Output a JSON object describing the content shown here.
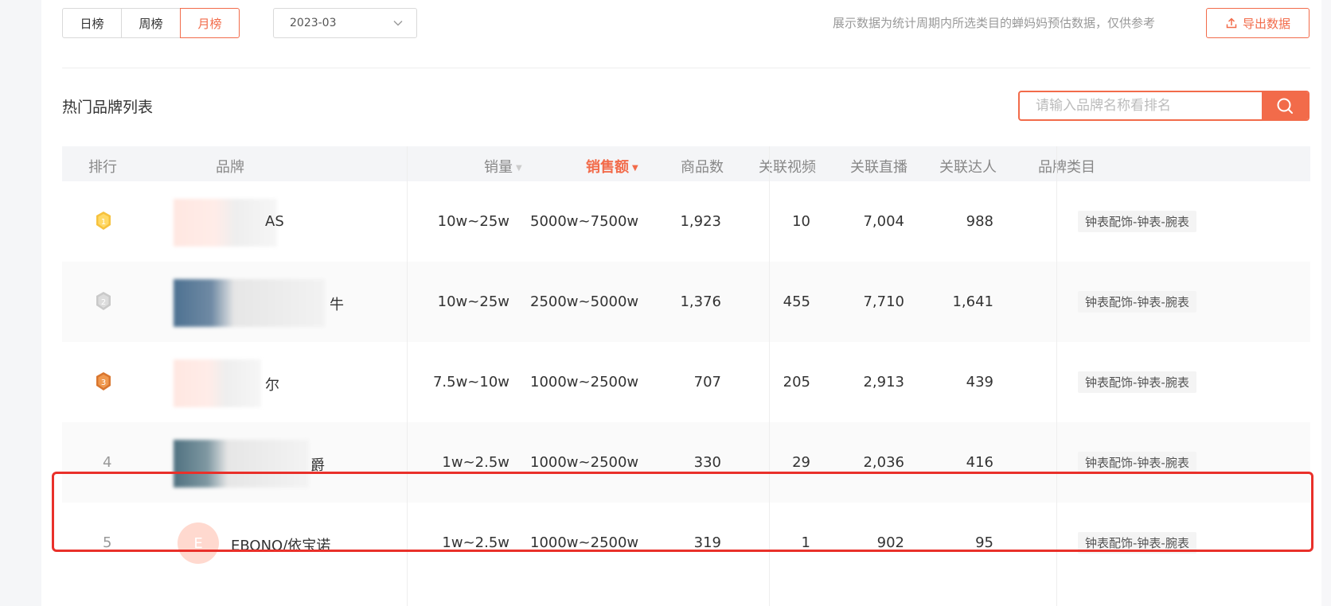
{
  "period_tabs": [
    {
      "label": "日榜",
      "active": false
    },
    {
      "label": "周榜",
      "active": false
    },
    {
      "label": "月榜",
      "active": true
    }
  ],
  "month_select": {
    "value": "2023-03"
  },
  "notice": "展示数据为统计周期内所选类目的蝉妈妈预估数据，仅供参考",
  "export_label": "导出数据",
  "section_title": "热门品牌列表",
  "search": {
    "placeholder": "请输入品牌名称看排名"
  },
  "colors": {
    "accent": "#f26b4a",
    "highlight": "#e9302a"
  },
  "table": {
    "headers": {
      "rank": "排行",
      "brand": "品牌",
      "sales": "销量",
      "revenue": "销售额",
      "products": "商品数",
      "videos": "关联视频",
      "lives": "关联直播",
      "creators": "关联达人",
      "category": "品牌类目"
    },
    "rows": [
      {
        "rank": "1",
        "brand": "AS",
        "sales": "10w~25w",
        "revenue": "5000w~7500w",
        "products": "1,923",
        "videos": "10",
        "lives": "7,004",
        "creators": "988",
        "category": "钟表配饰-钟表-腕表"
      },
      {
        "rank": "2",
        "brand": "牛",
        "sales": "10w~25w",
        "revenue": "2500w~5000w",
        "products": "1,376",
        "videos": "455",
        "lives": "7,710",
        "creators": "1,641",
        "category": "钟表配饰-钟表-腕表"
      },
      {
        "rank": "3",
        "brand": "尔",
        "sales": "7.5w~10w",
        "revenue": "1000w~2500w",
        "products": "707",
        "videos": "205",
        "lives": "2,913",
        "creators": "439",
        "category": "钟表配饰-钟表-腕表"
      },
      {
        "rank": "4",
        "brand": "爵",
        "sales": "1w~2.5w",
        "revenue": "1000w~2500w",
        "products": "330",
        "videos": "29",
        "lives": "2,036",
        "creators": "416",
        "category": "钟表配饰-钟表-腕表"
      },
      {
        "rank": "5",
        "brand": "EBONO/依宝诺",
        "avatar_letter": "E",
        "sales": "1w~2.5w",
        "revenue": "1000w~2500w",
        "products": "319",
        "videos": "1",
        "lives": "902",
        "creators": "95",
        "category": "钟表配饰-钟表-腕表"
      }
    ]
  }
}
